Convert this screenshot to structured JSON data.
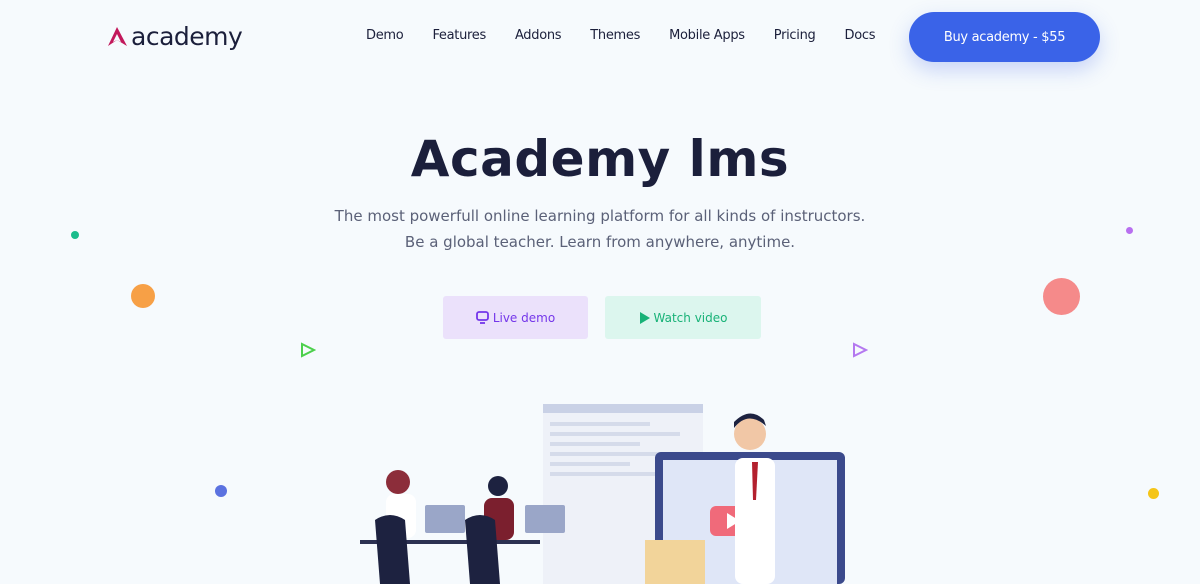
{
  "nav": {
    "logo_text": "academy",
    "items": [
      "Demo",
      "Features",
      "Addons",
      "Themes",
      "Mobile Apps",
      "Pricing",
      "Docs"
    ],
    "buy_label": "Buy academy - $55"
  },
  "hero": {
    "title": "Academy lms",
    "subtitle_line1": "The most powerfull online learning platform for all kinds of instructors.",
    "subtitle_line2": "Be a global teacher. Learn from anywhere, anytime.",
    "live_demo_label": "Live demo",
    "watch_video_label": "Watch video"
  },
  "colors": {
    "accent": "#3a63e8",
    "live": "#7436ea",
    "watch": "#18b277",
    "logo": "#c2185b"
  }
}
